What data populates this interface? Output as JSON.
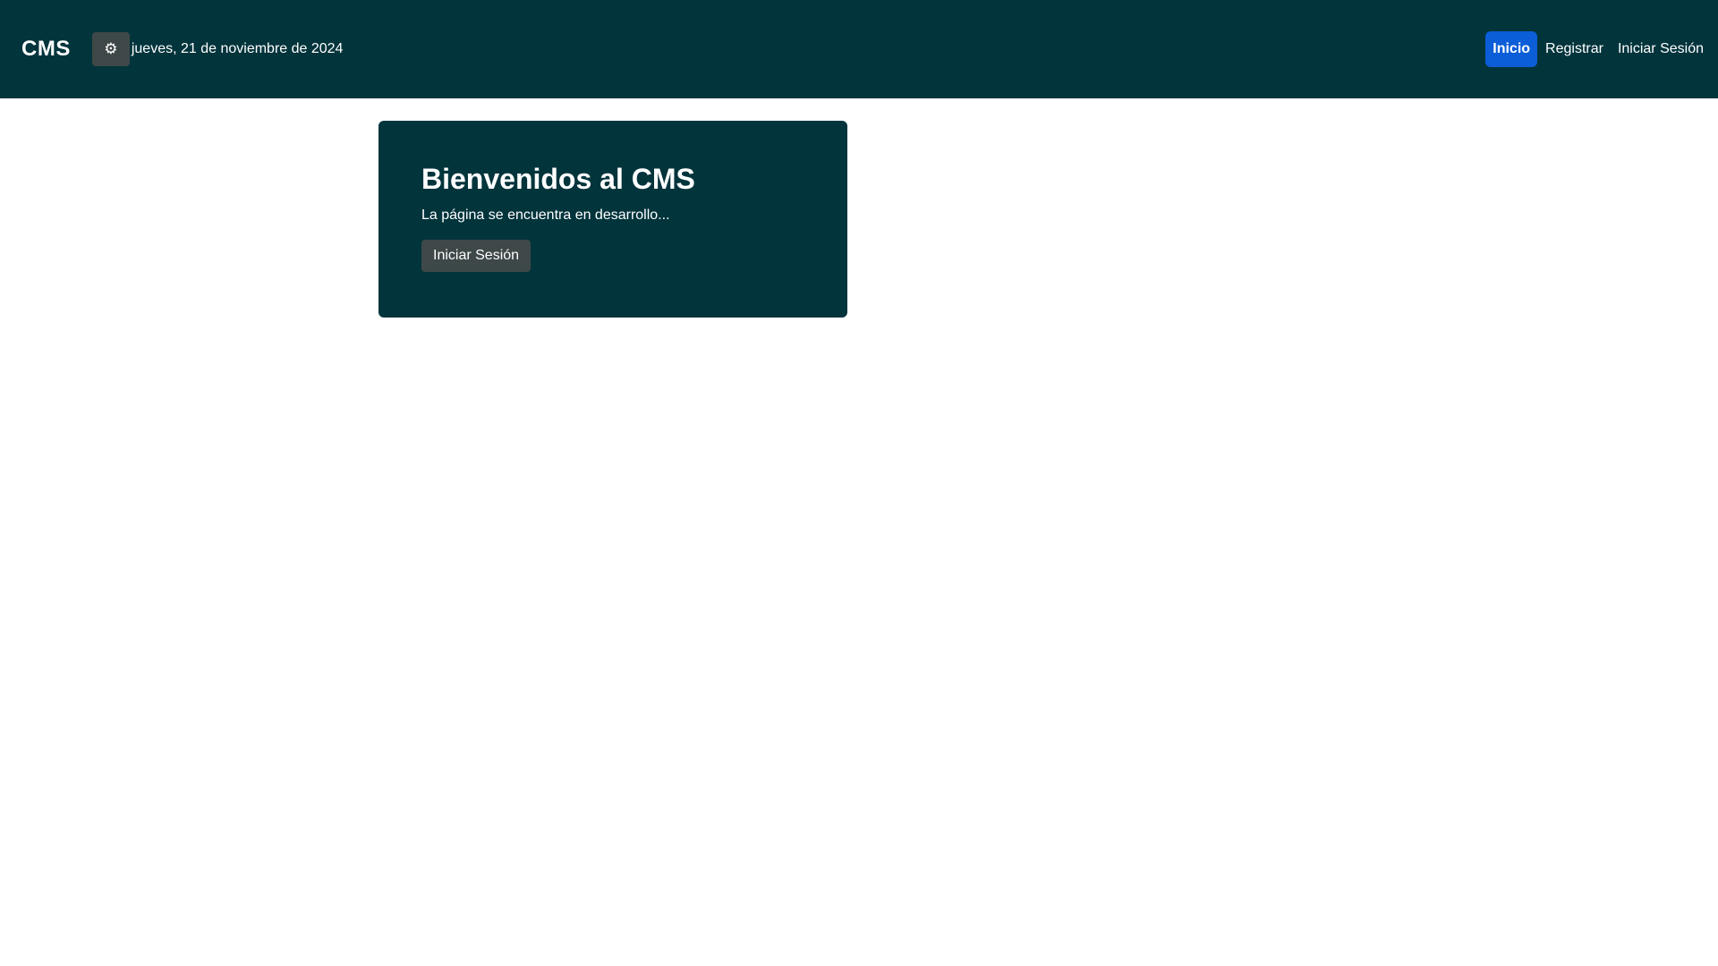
{
  "navbar": {
    "brand": "CMS",
    "theme_toggle_icon": "gear-icon",
    "date": "jueves, 21 de noviembre de 2024",
    "links": [
      {
        "label": "Inicio",
        "active": true
      },
      {
        "label": "Registrar",
        "active": false
      },
      {
        "label": "Iniciar Sesión",
        "active": false
      }
    ]
  },
  "hero": {
    "title": "Bienvenidos al CMS",
    "subtitle": "La página se encuentra en desarrollo...",
    "button_label": "Iniciar Sesión"
  },
  "colors": {
    "navbar_bg": "#02343c",
    "hero_bg": "#02343c",
    "active_link_bg": "#0b5ed7",
    "button_bg": "#3f4849"
  }
}
